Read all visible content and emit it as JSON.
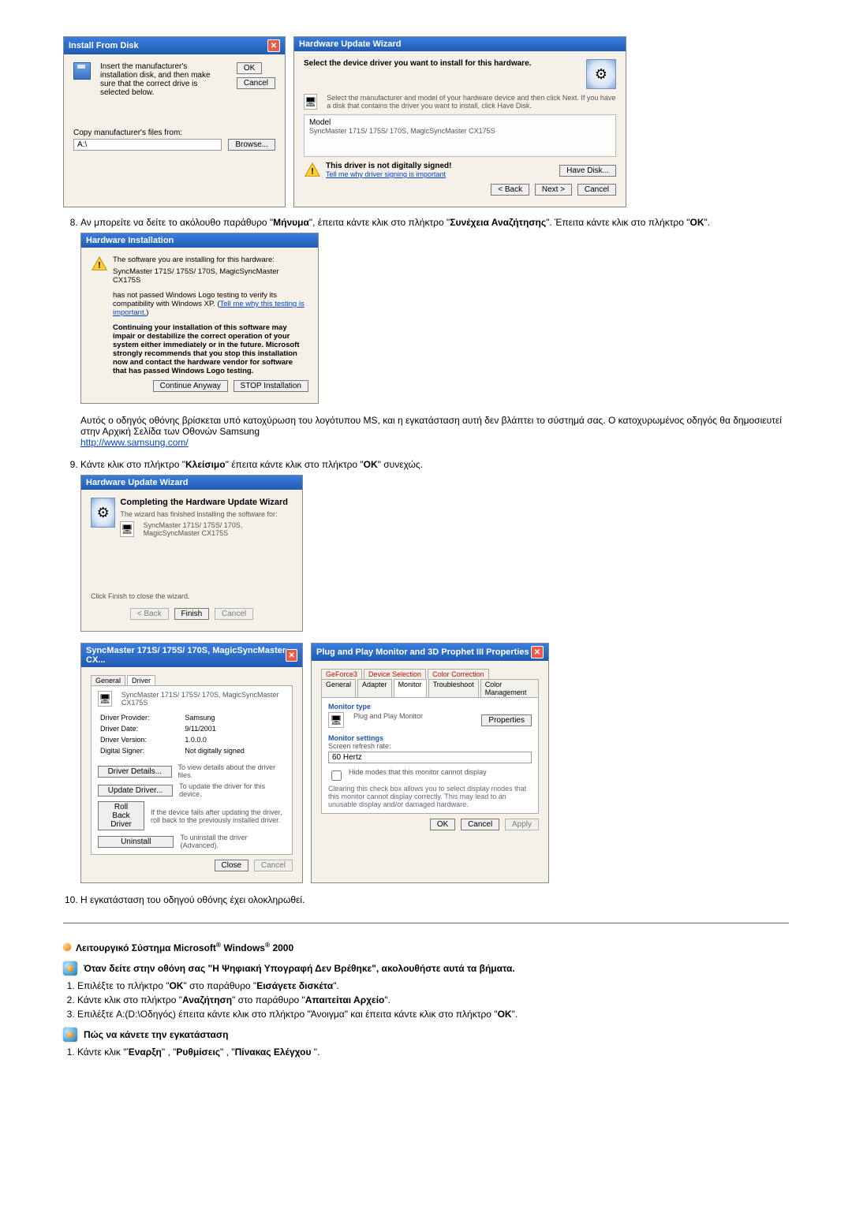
{
  "install_from_disk": {
    "title": "Install From Disk",
    "msg": "Insert the manufacturer's installation disk, and then make sure that the correct drive is selected below.",
    "ok": "OK",
    "cancel": "Cancel",
    "copy_label": "Copy manufacturer's files from:",
    "drive": "A:\\",
    "browse": "Browse..."
  },
  "hw_update_wizard": {
    "title": "Hardware Update Wizard",
    "select_label": "Select the device driver you want to install for this hardware.",
    "select_hint": "Select the manufacturer and model of your hardware device and then click Next. If you have a disk that contains the driver you want to install, click Have Disk.",
    "model_label": "Model",
    "model_value": "SyncMaster 171S/ 175S/ 170S, MagicSyncMaster CX175S",
    "warn_not_signed": "This driver is not digitally signed!",
    "tell_me": "Tell me why driver signing is important",
    "have_disk": "Have Disk...",
    "back": "< Back",
    "next": "Next >",
    "cancel": "Cancel"
  },
  "step8": {
    "text_a": "Αν μπορείτε να δείτε το ακόλουθο παράθυρο \"",
    "msg_bold": "Μήνυμα",
    "text_b": "\", έπειτα κάντε κλικ στο πλήκτρο \"",
    "cont_bold": "Συνέχεια Αναζήτησης",
    "text_c": "\". Έπειτα κάντε κλικ στο πλήκτρο \"",
    "ok_bold": "OK",
    "text_d": "\"."
  },
  "hw_install": {
    "title": "Hardware Installation",
    "line1": "The software you are installing for this hardware:",
    "line2": "SyncMaster 171S/ 175S/ 170S, MagicSyncMaster CX175S",
    "line3a": "has not passed Windows Logo testing to verify its compatibility with Windows XP. (",
    "line3_link": "Tell me why this testing is important.",
    "line3b": ")",
    "warn": "Continuing your installation of this software may impair or destabilize the correct operation of your system either immediately or in the future. Microsoft strongly recommends that you stop this installation now and contact the hardware vendor for software that has passed Windows Logo testing.",
    "continue": "Continue Anyway",
    "stop": "STOP Installation"
  },
  "logo_note": {
    "l1": "Αυτός ο οδηγός οθόνης βρίσκεται υπό κατοχύρωση του λογότυπου MS, και η εγκατάσταση αυτή δεν βλάπτει το σύστημά σας. Ο κατοχυρωμένος οδηγός θα δημοσιευτεί στην Αρχική Σελίδα των Οθονών Samsung",
    "url": "http://www.samsung.com/"
  },
  "step9": {
    "text_a": "Κάντε κλικ στο πλήκτρο \"",
    "close_bold": "Κλείσιμο",
    "text_b": "\" έπειτα κάντε κλικ στο πλήκτρο \"",
    "ok_bold": "OK",
    "text_c": "\" συνεχώς."
  },
  "complete_wizard": {
    "title": "Hardware Update Wizard",
    "heading": "Completing the Hardware Update Wizard",
    "line": "The wizard has finished installing the software for:",
    "device": "SyncMaster 171S/ 175S/ 170S, MagicSyncMaster CX175S",
    "click_finish": "Click Finish to close the wizard.",
    "back": "< Back",
    "finish": "Finish",
    "cancel": "Cancel"
  },
  "driver_props": {
    "title": "SyncMaster 171S/ 175S/ 170S, MagicSyncMaster CX...",
    "tab_general": "General",
    "tab_driver": "Driver",
    "device": "SyncMaster 171S/ 175S/ 170S, MagicSyncMaster CX175S",
    "provider_l": "Driver Provider:",
    "provider_v": "Samsung",
    "date_l": "Driver Date:",
    "date_v": "9/11/2001",
    "version_l": "Driver Version:",
    "version_v": "1.0.0.0",
    "signer_l": "Digital Signer:",
    "signer_v": "Not digitally signed",
    "details_btn": "Driver Details...",
    "details_txt": "To view details about the driver files.",
    "update_btn": "Update Driver...",
    "update_txt": "To update the driver for this device.",
    "rollback_btn": "Roll Back Driver",
    "rollback_txt": "If the device fails after updating the driver, roll back to the previously installed driver.",
    "uninstall_btn": "Uninstall",
    "uninstall_txt": "To uninstall the driver (Advanced).",
    "close": "Close",
    "cancel": "Cancel"
  },
  "pnp_props": {
    "title": "Plug and Play Monitor and 3D Prophet III Properties",
    "tabs_top": [
      "GeForce3",
      "Device Selection",
      "Color Correction"
    ],
    "tabs_bot": [
      "General",
      "Adapter",
      "Monitor",
      "Troubleshoot",
      "Color Management"
    ],
    "monitor_type": "Monitor type",
    "monitor_name": "Plug and Play Monitor",
    "properties": "Properties",
    "monitor_settings": "Monitor settings",
    "refresh_l": "Screen refresh rate:",
    "refresh_v": "60 Hertz",
    "hide_modes": "Hide modes that this monitor cannot display",
    "hide_hint": "Clearing this check box allows you to select display modes that this monitor cannot display correctly. This may lead to an unusable display and/or damaged hardware.",
    "ok": "OK",
    "cancel": "Cancel",
    "apply": "Apply"
  },
  "step10": "Η εγκατάσταση του οδηγού οθόνης έχει ολοκληρωθεί.",
  "win2000_header_a": "Λειτουργικό Σύστημα Microsoft",
  "win2000_header_b": " Windows",
  "win2000_header_c": " 2000",
  "dig_sig": {
    "heading": "Όταν δείτε στην οθόνη σας \"Η Ψηφιακή Υπογραφή Δεν Βρέθηκε\", ακολουθήστε αυτά τα βήματα.",
    "s1a": "Επιλέξτε το πλήκτρο \"",
    "s1_ok": "OK",
    "s1b": "\" στο παράθυρο \"",
    "s1_ins": "Εισάγετε δισκέτα",
    "s1c": "\".",
    "s2a": "Κάντε κλικ στο πλήκτρο \"",
    "s2_br": "Αναζήτηση",
    "s2b": "\" στο παράθυρο \"",
    "s2_req": "Απαιτείται Αρχείο",
    "s2c": "\".",
    "s3a": "Επιλέξτε A:(D:\\Οδηγός) έπειτα κάντε κλικ στο πλήκτρο \"Άνοιγμα\" και έπειτα κάντε κλικ στο πλήκτρο \"",
    "s3_ok": "OK",
    "s3b": "\"."
  },
  "howto": {
    "heading": "Πώς να κάνετε την εγκατάσταση",
    "s1a": "Κάντε κλικ \"",
    "s1_start": "Έναρξη",
    "s1b": "\" , \"",
    "s1_set": "Ρυθμίσεις",
    "s1c": "\" , \"",
    "s1_cp": "Πίνακας Ελέγχου",
    "s1d": " \"."
  }
}
